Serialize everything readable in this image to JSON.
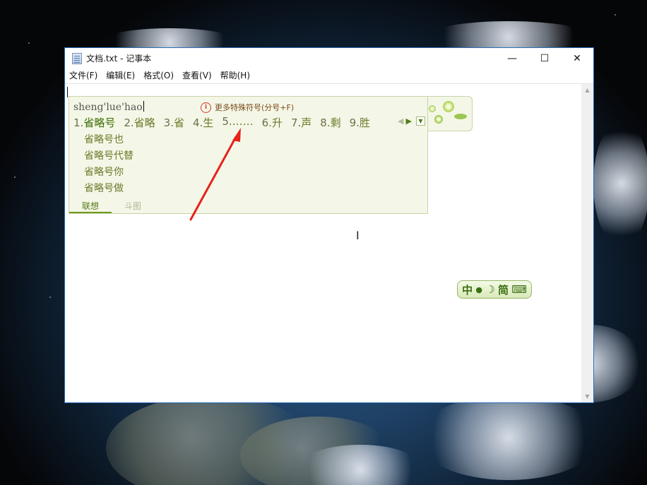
{
  "window": {
    "title": "文档.txt - 记事本",
    "controls": {
      "minimize": "—",
      "maximize": "☐",
      "close": "✕"
    }
  },
  "menu": {
    "items": [
      "文件(F)",
      "编辑(E)",
      "格式(O)",
      "查看(V)",
      "帮助(H)"
    ]
  },
  "ime": {
    "pinyin": "sheng'lue'hao",
    "hint": "更多特殊符号(分号+F)",
    "candidates": [
      {
        "num": "1.",
        "word": "省略号"
      },
      {
        "num": "2.",
        "word": "省略"
      },
      {
        "num": "3.",
        "word": "省"
      },
      {
        "num": "4.",
        "word": "生"
      },
      {
        "num": "5.",
        "word": "……"
      },
      {
        "num": "6.",
        "word": "升"
      },
      {
        "num": "7.",
        "word": "声"
      },
      {
        "num": "8.",
        "word": "剩"
      },
      {
        "num": "9.",
        "word": "胜"
      }
    ],
    "associations": [
      "省略号也",
      "省略号代替",
      "省略号你",
      "省略号做"
    ],
    "tabs": [
      "联想",
      "斗图"
    ]
  },
  "ime_status": {
    "mode": "中",
    "moon": "☽",
    "script": "简",
    "keyboard": "⌨"
  },
  "colors": {
    "accent": "#6f9a22",
    "annotation_arrow": "#e8211a"
  }
}
